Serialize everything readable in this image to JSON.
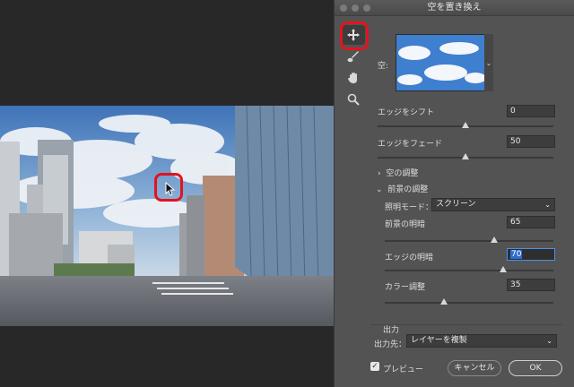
{
  "dialog": {
    "title": "空を置き換え",
    "sky_label": "空:",
    "edge_shift": {
      "label": "エッジをシフト",
      "value": "0",
      "level": 0.5
    },
    "edge_fade": {
      "label": "エッジをフェード",
      "value": "50",
      "level": 0.5
    },
    "sky_adjust_section": "空の調整",
    "foreground_section": "前景の調整",
    "lighting_mode": {
      "label": "照明モード：",
      "value": "スクリーン"
    },
    "foreground_lighting": {
      "label": "前景の明暗",
      "value": "65",
      "level": 0.65
    },
    "edge_lighting": {
      "label": "エッジの明暗",
      "value": "70",
      "level": 0.7
    },
    "color_adjust": {
      "label": "カラー調整",
      "value": "35",
      "level": 0.35
    },
    "output_section": "出力",
    "output_to": {
      "label": "出力先：",
      "value": "レイヤーを複製"
    },
    "preview_label": "プレビュー",
    "preview_checked": true,
    "cancel_label": "キャンセル",
    "ok_label": "OK"
  },
  "tools": [
    "move-icon",
    "brush-icon",
    "hand-icon",
    "zoom-icon"
  ],
  "colors": {
    "highlight": "#e0141e",
    "panel": "#535353",
    "accent": "#2f6bd3"
  }
}
